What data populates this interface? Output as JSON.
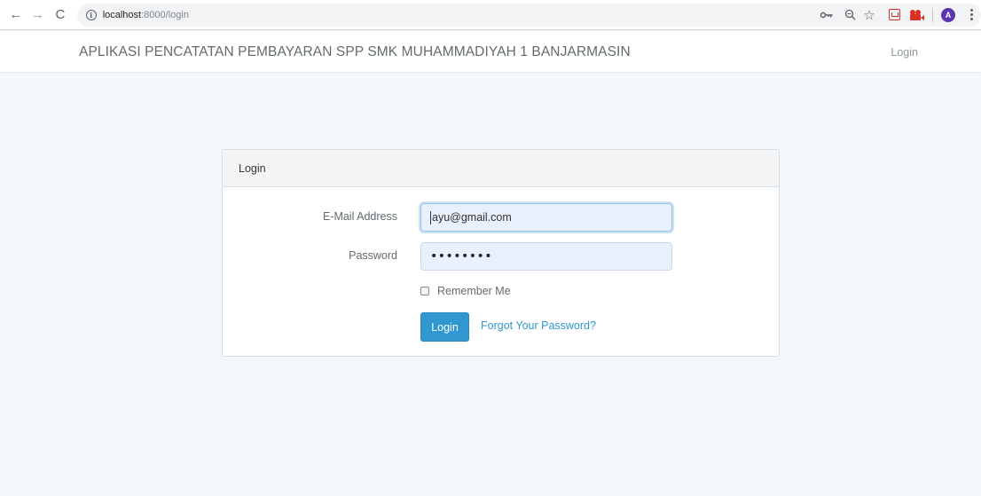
{
  "browser": {
    "url_host": "localhost",
    "url_path": ":8000/login",
    "avatar_letter": "A",
    "icons": [
      "back-arrow-icon",
      "forward-arrow-icon",
      "reload-icon",
      "info-icon",
      "key-icon",
      "zoom-icon",
      "star-icon",
      "extension-pocket-icon",
      "extension-camera-icon",
      "avatar",
      "menu-icon"
    ]
  },
  "navbar": {
    "brand": "APLIKASI PENCATATAN PEMBAYARAN SPP SMK MUHAMMADIYAH 1 BANJARMASIN",
    "login_link": "Login"
  },
  "card": {
    "title": "Login",
    "email_label": "E-Mail Address",
    "email_value": "ayu@gmail.com",
    "password_label": "Password",
    "password_value": "••••••••",
    "remember_label": "Remember Me",
    "remember_checked": false,
    "submit_label": "Login",
    "forgot_label": "Forgot Your Password?"
  },
  "colors": {
    "accent": "#3097d1",
    "page_bg": "#f5f8fa",
    "input_autofill_bg": "#e8f0fe"
  }
}
